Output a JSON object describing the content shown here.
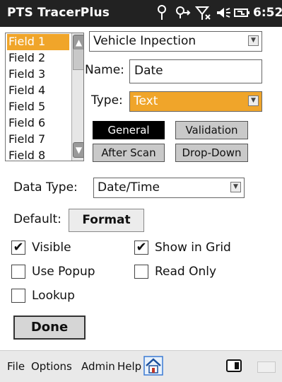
{
  "titlebar": {
    "title": "PTS TracerPlus",
    "time": "6:52"
  },
  "field_list": {
    "items": [
      "Field 1",
      "Field 2",
      "Field 3",
      "Field 4",
      "Field 5",
      "Field 6",
      "Field 7",
      "Field 8"
    ],
    "selected": "Field 1"
  },
  "form": {
    "form_select": "Vehicle Inpection",
    "name_label": "Name:",
    "name_value": "Date",
    "type_label": "Type:",
    "type_value": "Text",
    "tabs": {
      "general": "General",
      "validation": "Validation",
      "after_scan": "After Scan",
      "drop_down": "Drop-Down"
    },
    "data_type_label": "Data Type:",
    "data_type_value": "Date/Time",
    "default_label": "Default:",
    "format_button": "Format",
    "checkboxes": {
      "visible": "Visible",
      "show_in_grid": "Show in Grid",
      "use_popup": "Use Popup",
      "read_only": "Read Only",
      "lookup": "Lookup"
    },
    "done_button": "Done"
  },
  "menubar": {
    "file": "File",
    "options": "Options",
    "admin": "Admin",
    "help": "Help"
  },
  "checked": {
    "visible": true,
    "show_in_grid": true,
    "use_popup": false,
    "read_only": false,
    "lookup": false
  },
  "colors": {
    "accent": "#f0a52a",
    "titlebar": "#222222",
    "menubar": "#e9e9e9"
  },
  "icons": [
    "signal-icon",
    "sync-icon",
    "no-signal-icon",
    "volume-icon",
    "battery-icon",
    "home-icon",
    "keyboard-icon"
  ]
}
